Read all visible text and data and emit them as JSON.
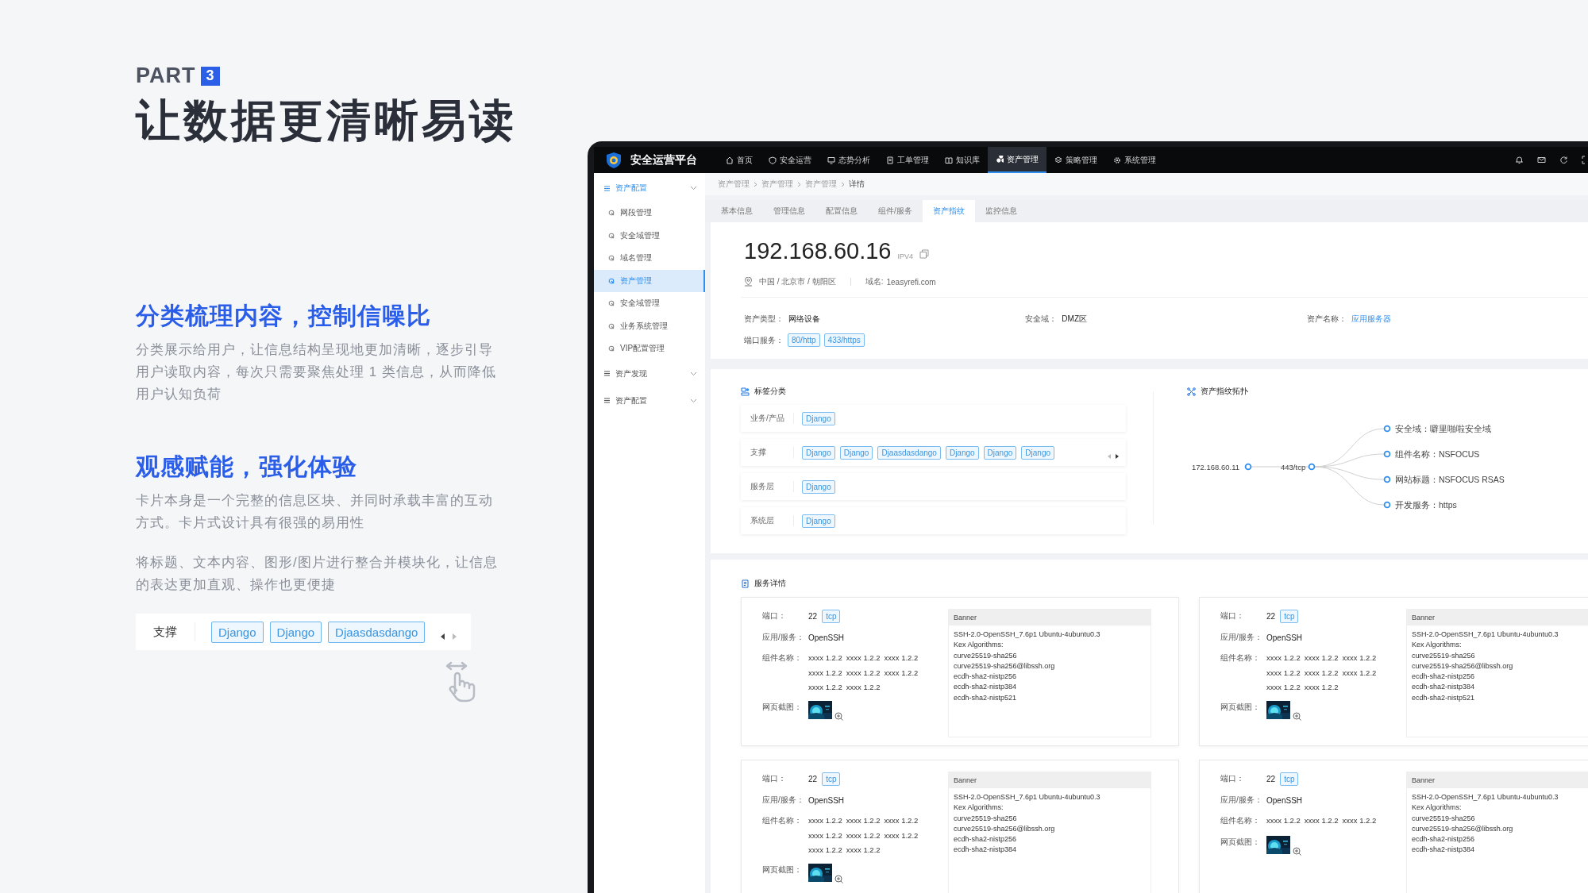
{
  "slide": {
    "part_label": "PART",
    "part_number": "3",
    "title": "让数据更清晰易读",
    "sections": [
      {
        "heading": "分类梳理内容，控制信噪比",
        "paragraphs": [
          "分类展示给用户，让信息结构呈现地更加清晰，逐步引导用户读取内容，每次只需要聚焦处理 1 类信息，从而降低用户认知负荷"
        ]
      },
      {
        "heading": "观感赋能，强化体验",
        "paragraphs": [
          "卡片本身是一个完整的信息区块、并同时承载丰富的互动方式。卡片式设计具有很强的易用性",
          "将标题、文本内容、图形/图片进行整合并模块化，让信息的表达更加直观、操作也更便捷"
        ]
      }
    ],
    "demo": {
      "label": "支撑",
      "tags": [
        "Django",
        "Django",
        "Djaasdasdango"
      ]
    }
  },
  "app": {
    "brand": "安全运营平台",
    "nav": [
      {
        "label": "首页",
        "selected": false
      },
      {
        "label": "安全运营",
        "selected": false
      },
      {
        "label": "态势分析",
        "selected": false
      },
      {
        "label": "工单管理",
        "selected": false
      },
      {
        "label": "知识库",
        "selected": false
      },
      {
        "label": "资产管理",
        "selected": true
      },
      {
        "label": "策略管理",
        "selected": false
      },
      {
        "label": "系统管理",
        "selected": false
      }
    ],
    "sidebar": [
      {
        "label": "资产配置",
        "selected": true,
        "expanded": true,
        "children": [
          {
            "label": "网段管理",
            "selected": false
          },
          {
            "label": "安全域管理",
            "selected": false
          },
          {
            "label": "域名管理",
            "selected": false
          },
          {
            "label": "资产管理",
            "selected": true
          },
          {
            "label": "安全域管理",
            "selected": false
          },
          {
            "label": "业务系统管理",
            "selected": false
          },
          {
            "label": "VIP配置管理",
            "selected": false
          }
        ]
      },
      {
        "label": "资产发现",
        "selected": false,
        "expanded": false
      },
      {
        "label": "资产配置",
        "selected": false,
        "expanded": false
      }
    ],
    "breadcrumb": [
      "资产管理",
      "资产管理",
      "资产管理",
      "详情"
    ],
    "tabs": [
      {
        "label": "基本信息",
        "selected": false
      },
      {
        "label": "管理信息",
        "selected": false
      },
      {
        "label": "配置信息",
        "selected": false
      },
      {
        "label": "组件/服务",
        "selected": false
      },
      {
        "label": "资产指纹",
        "selected": true
      },
      {
        "label": "监控信息",
        "selected": false
      }
    ],
    "asset": {
      "ip": "192.168.60.16",
      "ip_version": "IPV4",
      "location": "中国 / 北京市 / 朝阳区",
      "domain_label": "域名:",
      "domain": "1easyrefi.com",
      "fields": [
        {
          "label": "资产类型：",
          "value": "网络设备",
          "kind": "text"
        },
        {
          "label": "安全域：",
          "value": "DMZ区",
          "kind": "text"
        },
        {
          "label": "资产名称：",
          "value": "应用服务器",
          "kind": "link"
        }
      ],
      "ports_label": "端口服务：",
      "ports": [
        "80/http",
        "433/https"
      ]
    },
    "tag_panel": {
      "title": "标签分类",
      "rows": [
        {
          "label": "业务/产品",
          "tags": [
            "Django"
          ],
          "scrollable": false
        },
        {
          "label": "支撑",
          "tags": [
            "Django",
            "Django",
            "Djaasdasdango",
            "Django",
            "Django",
            "Django"
          ],
          "scrollable": true
        },
        {
          "label": "服务层",
          "tags": [
            "Django"
          ],
          "scrollable": false
        },
        {
          "label": "系统层",
          "tags": [
            "Django"
          ],
          "scrollable": false
        }
      ]
    },
    "topology": {
      "title": "资产指纹拓扑",
      "root": "172.168.60.11",
      "hub": "443/tcp",
      "leaves": [
        "安全域：噼里啪啦安全域",
        "组件名称：NSFOCUS",
        "网站标题：NSFOCUS RSAS",
        "开发服务：https"
      ]
    },
    "services": {
      "title": "服务详情",
      "cards": [
        {
          "port_label": "端口：",
          "port": "22",
          "protocol": "tcp",
          "app_label": "应用/服务：",
          "app": "OpenSSH",
          "component_label": "组件名称：",
          "components": [
            "xxxx 1.2.2",
            "xxxx 1.2.2",
            "xxxx 1.2.2",
            "xxxx 1.2.2",
            "xxxx 1.2.2",
            "xxxx 1.2.2",
            "xxxx 1.2.2",
            "xxxx 1.2.2"
          ],
          "screenshot_label": "网页截图：",
          "banner_title": "Banner",
          "banner_lines": [
            "SSH-2.0-OpenSSH_7.6p1 Ubuntu-4ubuntu0.3",
            "Kex Algorithms:",
            "curve25519-sha256",
            "curve25519-sha256@libssh.org",
            "ecdh-sha2-nistp256",
            "ecdh-sha2-nistp384",
            "ecdh-sha2-nistp521"
          ]
        },
        {
          "port_label": "端口：",
          "port": "22",
          "protocol": "tcp",
          "app_label": "应用/服务：",
          "app": "OpenSSH",
          "component_label": "组件名称：",
          "components": [
            "xxxx 1.2.2",
            "xxxx 1.2.2",
            "xxxx 1.2.2",
            "xxxx 1.2.2",
            "xxxx 1.2.2",
            "xxxx 1.2.2",
            "xxxx 1.2.2",
            "xxxx 1.2.2"
          ],
          "screenshot_label": "网页截图：",
          "banner_title": "Banner",
          "banner_lines": [
            "SSH-2.0-OpenSSH_7.6p1 Ubuntu-4ubuntu0.3",
            "Kex Algorithms:",
            "curve25519-sha256",
            "curve25519-sha256@libssh.org",
            "ecdh-sha2-nistp256",
            "ecdh-sha2-nistp384",
            "ecdh-sha2-nistp521"
          ]
        },
        {
          "port_label": "端口：",
          "port": "22",
          "protocol": "tcp",
          "app_label": "应用/服务：",
          "app": "OpenSSH",
          "component_label": "组件名称：",
          "components": [
            "xxxx 1.2.2",
            "xxxx 1.2.2",
            "xxxx 1.2.2",
            "xxxx 1.2.2",
            "xxxx 1.2.2",
            "xxxx 1.2.2",
            "xxxx 1.2.2",
            "xxxx 1.2.2"
          ],
          "screenshot_label": "网页截图：",
          "banner_title": "Banner",
          "banner_lines": [
            "SSH-2.0-OpenSSH_7.6p1 Ubuntu-4ubuntu0.3",
            "Kex Algorithms:",
            "curve25519-sha256",
            "curve25519-sha256@libssh.org",
            "ecdh-sha2-nistp256",
            "ecdh-sha2-nistp384"
          ]
        },
        {
          "port_label": "端口：",
          "port": "22",
          "protocol": "tcp",
          "app_label": "应用/服务：",
          "app": "OpenSSH",
          "component_label": "组件名称：",
          "components": [
            "xxxx 1.2.2",
            "xxxx 1.2.2",
            "xxxx 1.2.2"
          ],
          "screenshot_label": "网页截图：",
          "banner_title": "Banner",
          "banner_lines": [
            "SSH-2.0-OpenSSH_7.6p1 Ubuntu-4ubuntu0.3",
            "Kex Algorithms:",
            "curve25519-sha256",
            "curve25519-sha256@libssh.org",
            "ecdh-sha2-nistp256",
            "ecdh-sha2-nistp384"
          ]
        }
      ]
    }
  }
}
